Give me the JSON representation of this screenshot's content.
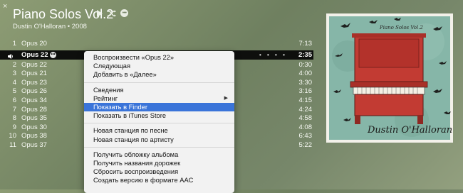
{
  "window": {
    "close_label": "×"
  },
  "album": {
    "title": "Piano Solos Vol.2",
    "meta": "Dustin O'Halloran • 2008",
    "more_label": "•••"
  },
  "tracks": [
    {
      "num": "1",
      "name": "Opus 20",
      "time": "7:13"
    },
    {
      "num": "",
      "name": "Opus 22",
      "time": "2:35",
      "playing": true,
      "more_label": "•••"
    },
    {
      "num": "2",
      "name": "Opus 22",
      "time": "0:30"
    },
    {
      "num": "3",
      "name": "Opus 21",
      "time": "4:00"
    },
    {
      "num": "4",
      "name": "Opus 23",
      "time": "3:30"
    },
    {
      "num": "5",
      "name": "Opus 26",
      "time": "3:16"
    },
    {
      "num": "6",
      "name": "Opus 34",
      "time": "4:15"
    },
    {
      "num": "7",
      "name": "Opus 28",
      "time": "4:24"
    },
    {
      "num": "8",
      "name": "Opus 35",
      "time": "4:58"
    },
    {
      "num": "9",
      "name": "Opus 30",
      "time": "4:08"
    },
    {
      "num": "10",
      "name": "Opus 38",
      "time": "6:43"
    },
    {
      "num": "11",
      "name": "Opus 37",
      "time": "5:22"
    }
  ],
  "playing_progress_label": "• • • •",
  "context_menu": {
    "groups": [
      [
        "Воспроизвести «Opus 22»",
        "Следующая",
        "Добавить в «Далее»"
      ],
      [
        "Сведения",
        "Рейтинг",
        "Показать в Finder",
        "Показать в iTunes Store"
      ],
      [
        "Новая станция по песне",
        "Новая станция по артисту"
      ],
      [
        "Получить обложку альбома",
        "Получить названия дорожек",
        "Сбросить воспроизведения",
        "Создать версию в формате AAC"
      ]
    ],
    "highlighted": "Показать в Finder",
    "submenu_item": "Рейтинг"
  },
  "album_art": {
    "handwritten_title": "Piano Solos Vol.2",
    "handwritten_artist": "Dustin O'Halloran",
    "colors": {
      "background": "#86b6a8",
      "piano": "#c23b33",
      "birds": "#1f211f"
    }
  }
}
